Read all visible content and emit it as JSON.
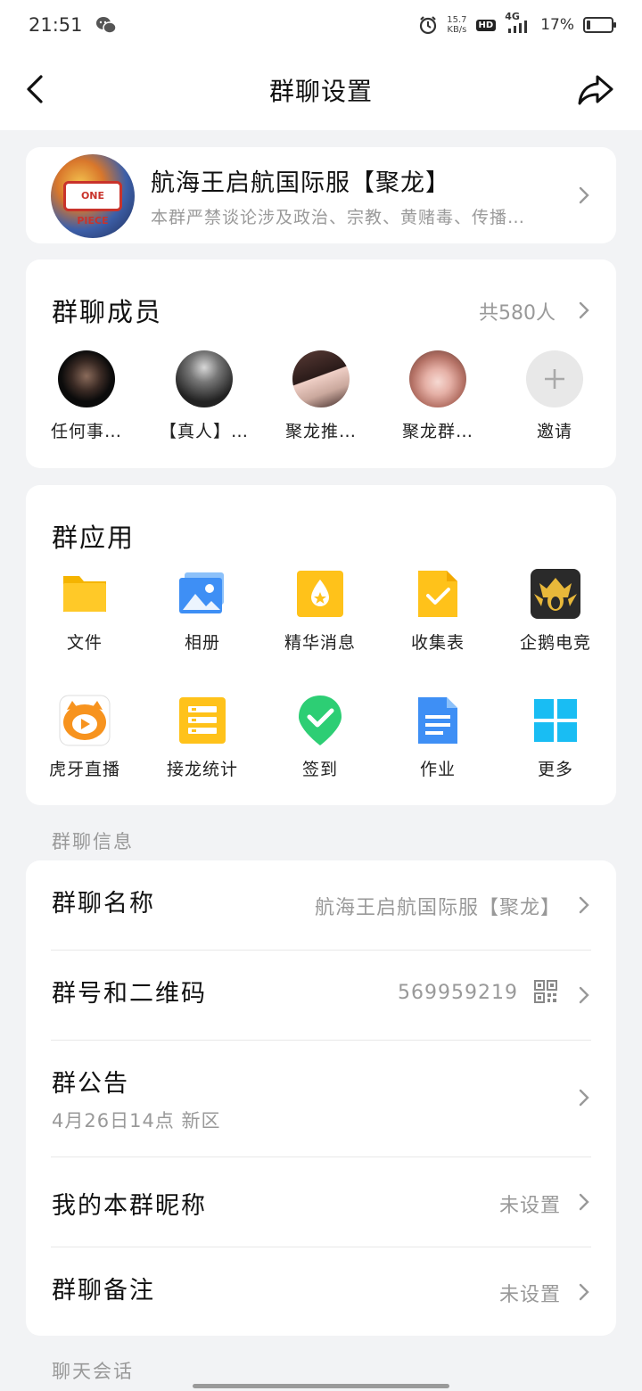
{
  "status_bar": {
    "time": "21:51",
    "net_speed_value": "15.7",
    "net_speed_unit": "KB/s",
    "hd_label": "HD",
    "network": "4G",
    "battery": "17%",
    "battery_level": 0.17
  },
  "nav": {
    "title": "群聊设置"
  },
  "group": {
    "name": "航海王启航国际服【聚龙】",
    "description": "本群严禁谈论涉及政治、宗教、黄赌毒、传播…",
    "avatar_text": "ONE PIECE"
  },
  "members": {
    "heading": "群聊成员",
    "count": "共580人",
    "list": [
      {
        "label": "任何事…"
      },
      {
        "label": "【真人】…"
      },
      {
        "label": "聚龙推…"
      },
      {
        "label": "聚龙群…"
      },
      {
        "label": "邀请"
      }
    ]
  },
  "apps": {
    "heading": "群应用",
    "items": [
      {
        "label": "文件",
        "icon": "folder-icon"
      },
      {
        "label": "相册",
        "icon": "photo-album-icon"
      },
      {
        "label": "精华消息",
        "icon": "essence-message-icon"
      },
      {
        "label": "收集表",
        "icon": "collection-form-icon"
      },
      {
        "label": "企鹅电竞",
        "icon": "penguin-esports-icon"
      },
      {
        "label": "虎牙直播",
        "icon": "huya-live-icon"
      },
      {
        "label": "接龙统计",
        "icon": "solitaire-stats-icon"
      },
      {
        "label": "签到",
        "icon": "check-in-icon"
      },
      {
        "label": "作业",
        "icon": "homework-icon"
      },
      {
        "label": "更多",
        "icon": "more-apps-icon"
      }
    ]
  },
  "info": {
    "section_label": "群聊信息",
    "group_name": {
      "label": "群聊名称",
      "value": "航海王启航国际服【聚龙】"
    },
    "group_id": {
      "label": "群号和二维码",
      "value": "569959219"
    },
    "announcement": {
      "label": "群公告",
      "value": "4月26日14点 新区"
    },
    "my_nickname": {
      "label": "我的本群昵称",
      "value": "未设置"
    },
    "remark": {
      "label": "群聊备注",
      "value": "未设置"
    }
  },
  "chat_section_label": "聊天会话",
  "colors": {
    "background": "#f2f3f5",
    "card": "#ffffff",
    "secondary_text": "#999999",
    "accent_yellow": "#ffc21a",
    "accent_blue": "#3e8ff5",
    "accent_green": "#2dce74",
    "accent_cyan": "#19bdf3"
  }
}
